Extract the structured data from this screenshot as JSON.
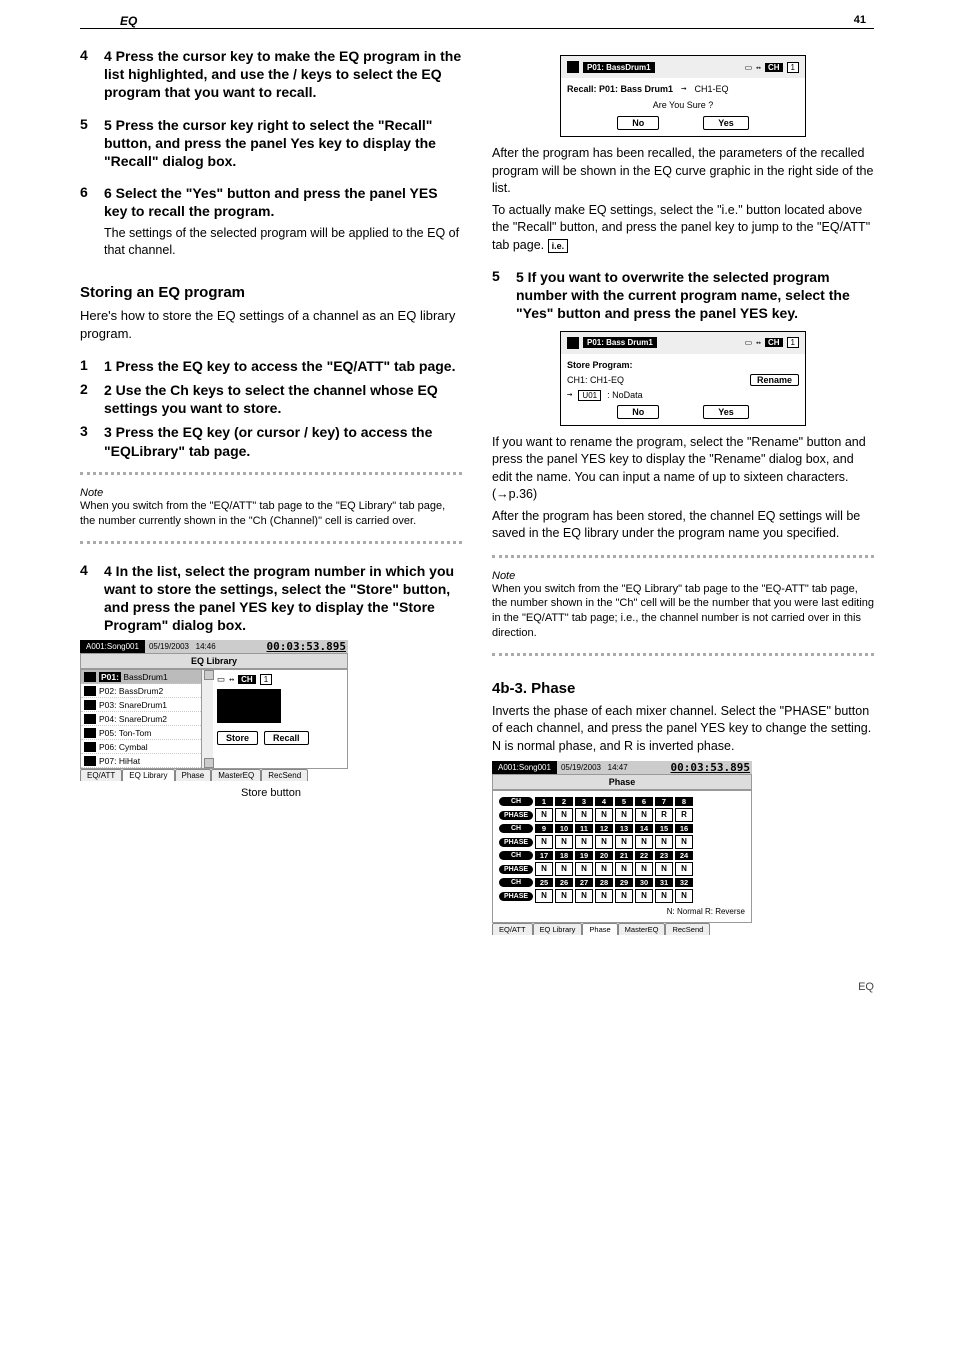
{
  "page_number": "41",
  "header_title": "EQ",
  "left": {
    "step4": {
      "head": "4 Press the cursor key   to make the EQ program in the list highlighted, and use the     /    keys to select the EQ program that you want to recall."
    },
    "step5": {
      "head": "5 Press the cursor key right to select the \"Recall\" button, and press the panel Yes key to display the \"Recall\" dialog box."
    },
    "step6": {
      "head": "6 Select the \"Yes\" button and press the panel YES key to recall the program.",
      "body": "The settings of the selected program will be applied to the EQ of that channel."
    },
    "store_title": "Storing an EQ program",
    "store_intro": "Here's how to store the EQ settings of a channel as an EQ library program.",
    "s1": {
      "head": "1 Press the EQ key to access the \"EQ/ATT\" tab page."
    },
    "s2": {
      "head": "2 Use the Ch keys to select the channel whose EQ settings you want to store."
    },
    "s3": {
      "head": "3 Press the EQ key (or cursor     /     key) to access the \"EQLibrary\" tab page."
    },
    "note1_label": "Note",
    "note1": "When you switch from the \"EQ/ATT\" tab page to the \"EQ Library\" tab page, the number currently shown in the \"Ch (Channel)\" cell is carried over.",
    "s4": {
      "head": "4 In the list, select the program number in which you want to store the settings, select the \"Store\" button, and press the panel YES key to display the \"Store Program\" dialog box."
    }
  },
  "right": {
    "recall": {
      "program": "P01: BassDrum1",
      "line": "Recall: P01: Bass Drum1",
      "target": "CH1-EQ",
      "confirm": "Are You Sure ?",
      "no": "No",
      "yes": "Yes"
    },
    "after_recall": "After the program has been recalled, the parameters of the recalled program will be shown in the EQ curve graphic in the right side of the list.",
    "tip_line": "To actually make EQ settings, select the \"i.e.\" button located above the \"Recall\" button, and press the panel       key to jump to the \"EQ/ATT\" tab page.",
    "s5": {
      "head": "5 If you want to overwrite the selected program number with the current program name, select the \"Yes\" button and press the panel YES key."
    },
    "store": {
      "title": "Store Program:",
      "ch": "CH1: CH1-EQ",
      "rename": "Rename",
      "to_slot": "U01",
      "to_name": ": NoData",
      "no": "No",
      "yes": "Yes"
    },
    "store_body1": "If you want to rename the program, select the \"Rename\" button and press the panel YES key to display the \"Rename\" dialog box, and edit the name. You can input a name of up to sixteen characters. (→p.36)",
    "after_store": "After the program has been stored, the channel EQ settings will be saved in the EQ library under the program name you specified.",
    "note2_label": "Note",
    "note2": "When you switch from the \"EQ Library\" tab page to the \"EQ-ATT\" tab page, the number shown in the \"Ch\" cell will be the number that you were last editing in the \"EQ/ATT\" tab page; i.e., the channel number is not carried over in this direction.",
    "phase_title": "4b-3. Phase",
    "phase_body": "Inverts the phase of each mixer channel. Select the \"PHASE\" button of each channel, and press the panel YES key to change the setting. N is normal phase, and R is inverted phase."
  },
  "eqLib": {
    "songid": "A001:Song001",
    "date": "05/19/2003",
    "clock": "14:46",
    "counter": "00:03:53.895",
    "title": "EQ Library",
    "items": [
      "P01: BassDrum1",
      "P02: BassDrum2",
      "P03: SnareDrum1",
      "P04: SnareDrum2",
      "P05: Ton-Tom",
      "P06: Cymbal",
      "P07: HiHat"
    ],
    "ch_label": "CH",
    "ch_val": "1",
    "store": "Store",
    "recall": "Recall",
    "tabs": [
      "EQ/ATT",
      "EQ Library",
      "Phase",
      "MasterEQ",
      "RecSend"
    ],
    "store_callout": "Store button"
  },
  "phaseShot": {
    "songid": "A001:Song001",
    "date": "05/19/2003",
    "clock": "14:47",
    "counter": "00:03:53.895",
    "title": "Phase",
    "rows": [
      {
        "ch": [
          "1",
          "2",
          "3",
          "4",
          "5",
          "6",
          "7",
          "8"
        ],
        "ph": [
          "N",
          "N",
          "N",
          "N",
          "N",
          "N",
          "R",
          "R"
        ]
      },
      {
        "ch": [
          "9",
          "10",
          "11",
          "12",
          "13",
          "14",
          "15",
          "16"
        ],
        "ph": [
          "N",
          "N",
          "N",
          "N",
          "N",
          "N",
          "N",
          "N"
        ]
      },
      {
        "ch": [
          "17",
          "18",
          "19",
          "20",
          "21",
          "22",
          "23",
          "24"
        ],
        "ph": [
          "N",
          "N",
          "N",
          "N",
          "N",
          "N",
          "N",
          "N"
        ]
      },
      {
        "ch": [
          "25",
          "26",
          "27",
          "28",
          "29",
          "30",
          "31",
          "32"
        ],
        "ph": [
          "N",
          "N",
          "N",
          "N",
          "N",
          "N",
          "N",
          "N"
        ]
      }
    ],
    "legend": "N: Normal   R: Reverse",
    "tabs": [
      "EQ/ATT",
      "EQ Library",
      "Phase",
      "MasterEQ",
      "RecSend"
    ]
  },
  "footer": "EQ"
}
